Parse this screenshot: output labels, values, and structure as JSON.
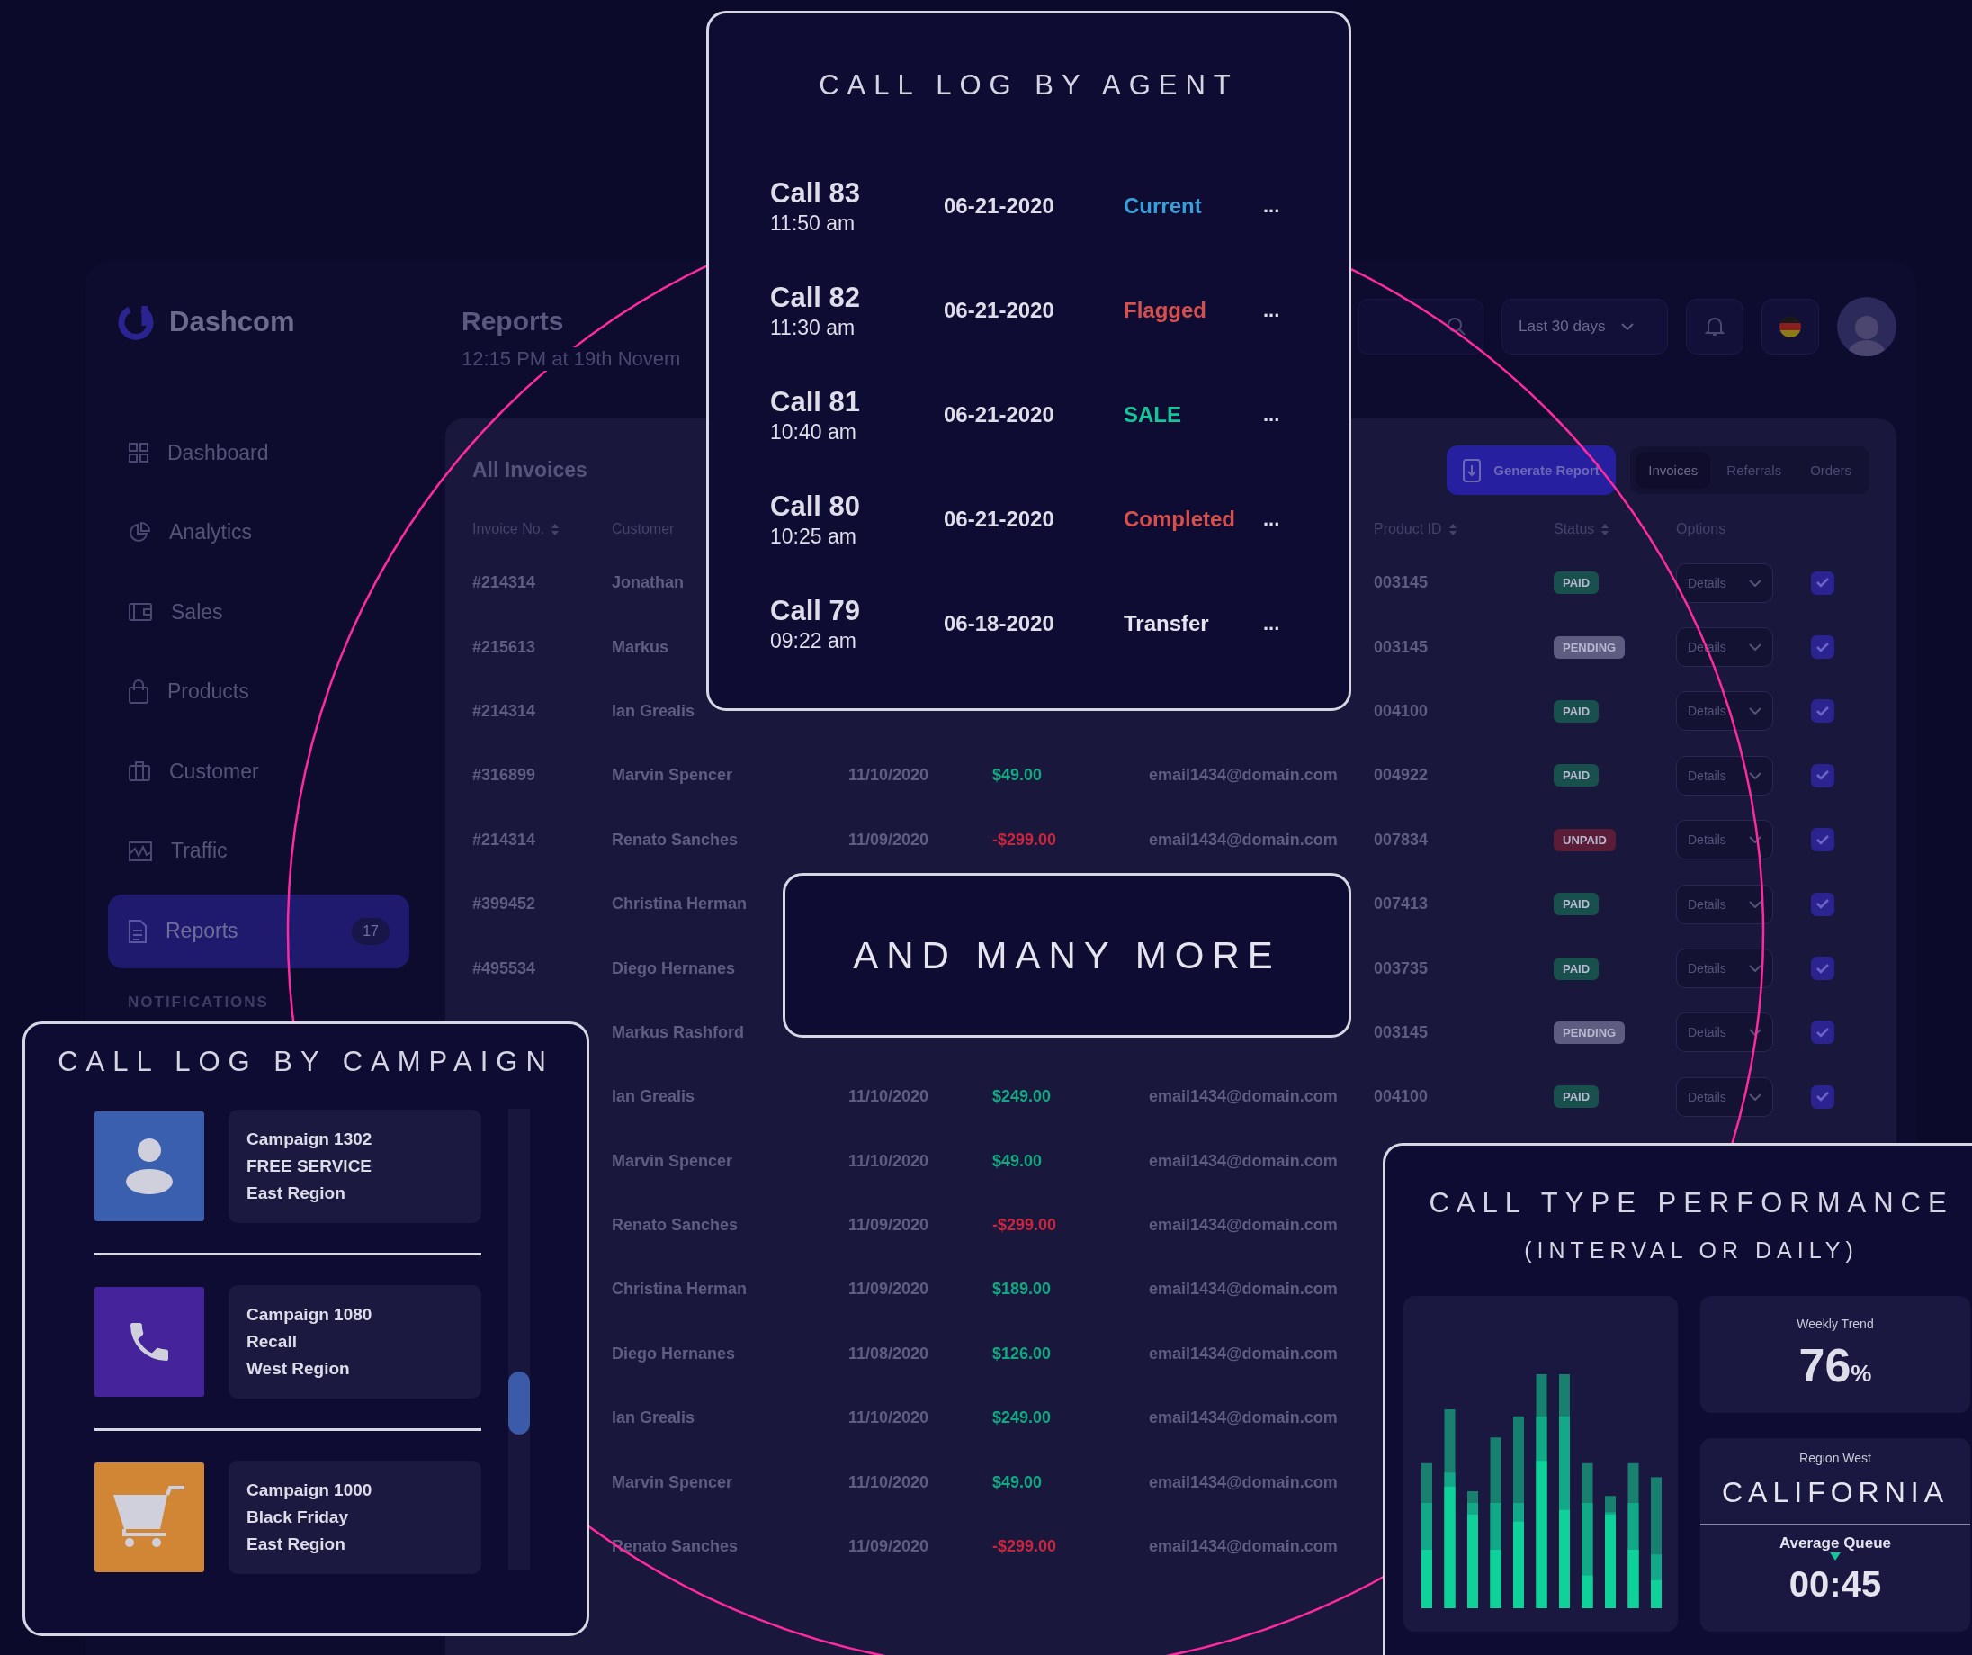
{
  "sidebar": {
    "logo": "Dashcom",
    "items": [
      {
        "label": "Dashboard",
        "kind": "grid",
        "selected": false
      },
      {
        "label": "Analytics",
        "kind": "pie",
        "selected": false
      },
      {
        "label": "Sales",
        "kind": "wallet",
        "selected": false
      },
      {
        "label": "Products",
        "kind": "bag",
        "selected": false
      },
      {
        "label": "Customer",
        "kind": "briefcase",
        "selected": false
      },
      {
        "label": "Traffic",
        "kind": "pulse",
        "selected": false
      },
      {
        "label": "Reports",
        "kind": "document",
        "selected": true,
        "badge": "17"
      }
    ],
    "section_heading": "NOTIFICATIONS"
  },
  "header": {
    "title": "Reports",
    "subtitle": "12:15 PM at 19th Novem",
    "range_dropdown": "Last 30 days"
  },
  "invoices": {
    "title": "All Invoices",
    "generate_button": "Generate Report",
    "tabs": [
      {
        "label": "Invoices",
        "selected": true
      },
      {
        "label": "Referrals",
        "selected": false
      },
      {
        "label": "Orders",
        "selected": false
      }
    ],
    "columns": {
      "invoice": {
        "label": "Invoice No.",
        "sortable": true
      },
      "customer": {
        "label": "Customer",
        "sortable": false
      },
      "product_id": {
        "label": "Product ID",
        "sortable": true
      },
      "status": {
        "label": "Status",
        "sortable": true
      },
      "options": {
        "label": "Options",
        "sortable": false
      }
    },
    "rows": [
      {
        "invoice": "#214314",
        "customer": "Jonathan",
        "product_id": "003145",
        "status": {
          "label": "PAID",
          "color": "#17504c"
        },
        "options": "Details",
        "checked": true
      },
      {
        "invoice": "#215613",
        "customer": "Markus",
        "product_id": "003145",
        "status": {
          "label": "PENDING",
          "color": "#5e5c80"
        },
        "options": "Details",
        "checked": true
      },
      {
        "invoice": "#214314",
        "customer": "Ian Grealis",
        "product_id": "004100",
        "status": {
          "label": "PAID",
          "color": "#17504c"
        },
        "options": "Details",
        "checked": true
      },
      {
        "invoice": "#316899",
        "customer": "Marvin Spencer",
        "date": "11/10/2020",
        "amount": {
          "text": "$49.00",
          "color": "#14a882"
        },
        "email": "email1434@domain.com",
        "product_id": "004922",
        "status": {
          "label": "PAID",
          "color": "#17504c"
        },
        "options": "Details",
        "checked": true
      },
      {
        "invoice": "#214314",
        "customer": "Renato Sanches",
        "date": "11/09/2020",
        "amount": {
          "text": "-$299.00",
          "color": "#c8263e"
        },
        "email": "email1434@domain.com",
        "product_id": "007834",
        "status": {
          "label": "UNPAID",
          "color": "#5a1c36"
        },
        "options": "Details",
        "checked": true
      },
      {
        "invoice": "#399452",
        "customer": "Christina Herman",
        "product_id": "007413",
        "status": {
          "label": "PAID",
          "color": "#17504c"
        },
        "options": "Details",
        "checked": true
      },
      {
        "invoice": "#495534",
        "customer": "Diego Hernanes",
        "product_id": "003735",
        "status": {
          "label": "PAID",
          "color": "#17504c"
        },
        "options": "Details",
        "checked": true
      },
      {
        "customer": "Markus Rashford",
        "product_id": "003145",
        "status": {
          "label": "PENDING",
          "color": "#5e5c80"
        },
        "options": "Details",
        "checked": true
      },
      {
        "customer": "Ian Grealis",
        "date": "11/10/2020",
        "amount": {
          "text": "$249.00",
          "color": "#14a882"
        },
        "email": "email1434@domain.com",
        "product_id": "004100",
        "status": {
          "label": "PAID",
          "color": "#17504c"
        },
        "options": "Details",
        "checked": true
      },
      {
        "customer": "Marvin Spencer",
        "date": "11/10/2020",
        "amount": {
          "text": "$49.00",
          "color": "#14a882"
        },
        "email": "email1434@domain.com"
      },
      {
        "customer": "Renato Sanches",
        "date": "11/09/2020",
        "amount": {
          "text": "-$299.00",
          "color": "#c8263e"
        },
        "email": "email1434@domain.com"
      },
      {
        "customer": "Christina Herman",
        "date": "11/09/2020",
        "amount": {
          "text": "$189.00",
          "color": "#14a882"
        },
        "email": "email1434@domain.com"
      },
      {
        "customer": "Diego Hernanes",
        "date": "11/08/2020",
        "amount": {
          "text": "$126.00",
          "color": "#14a882"
        },
        "email": "email1434@domain.com"
      },
      {
        "customer": "Ian Grealis",
        "date": "11/10/2020",
        "amount": {
          "text": "$249.00",
          "color": "#14a882"
        },
        "email": "email1434@domain.com"
      },
      {
        "customer": "Marvin Spencer",
        "date": "11/10/2020",
        "amount": {
          "text": "$49.00",
          "color": "#14a882"
        },
        "email": "email1434@domain.com"
      },
      {
        "customer": "Renato Sanches",
        "date": "11/09/2020",
        "amount": {
          "text": "-$299.00",
          "color": "#c8263e"
        },
        "email": "email1434@domain.com"
      }
    ]
  },
  "call_log_by_agent": {
    "title": "CALL LOG BY AGENT",
    "calls": [
      {
        "call": "Call 83",
        "time": "11:50 am",
        "date": "06-21-2020",
        "status": "Current",
        "color": "#3a9fd8",
        "menu": "..."
      },
      {
        "call": "Call 82",
        "time": "11:30 am",
        "date": "06-21-2020",
        "status": "Flagged",
        "color": "#d5504c",
        "menu": "..."
      },
      {
        "call": "Call 81",
        "time": "10:40 am",
        "date": "06-21-2020",
        "status": "SALE",
        "color": "#16c49a",
        "menu": "..."
      },
      {
        "call": "Call 80",
        "time": "10:25 am",
        "date": "06-21-2020",
        "status": "Completed",
        "color": "#d5504c",
        "menu": "..."
      },
      {
        "call": "Call 79",
        "time": "09:22 am",
        "date": "06-18-2020",
        "status": "Transfer",
        "color": "#e4e4ee",
        "menu": "..."
      }
    ]
  },
  "banner": {
    "text": "AND MANY MORE"
  },
  "call_log_by_campaign": {
    "title": "CALL LOG BY CAMPAIGN",
    "items": [
      {
        "kind": "person",
        "color": "#3a5fae",
        "lines": [
          "Campaign 1302",
          "FREE SERVICE",
          "East Region"
        ]
      },
      {
        "kind": "phone",
        "color": "#45239a",
        "lines": [
          "Campaign 1080",
          "Recall",
          "West Region"
        ]
      },
      {
        "kind": "cart",
        "color": "#d08634",
        "lines": [
          "Campaign 1000",
          "Black Friday",
          "East Region"
        ]
      }
    ]
  },
  "call_type_performance": {
    "title": "CALL TYPE PERFORMANCE",
    "subtitle": "(INTERVAL OR DAILY)",
    "weekly_trend": {
      "label": "Weekly Trend",
      "value": "76",
      "unit": "%"
    },
    "region": {
      "label": "Region West",
      "name": "CALIFORNIA"
    },
    "queue": {
      "label": "Average Queue",
      "value": "00:45"
    }
  }
}
